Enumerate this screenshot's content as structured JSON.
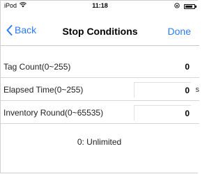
{
  "status_bar": {
    "carrier": "iPod",
    "wifi_icon": "wifi-icon",
    "time": "11:18",
    "battery_level": 0.8
  },
  "nav": {
    "back_label": "Back",
    "title": "Stop Conditions",
    "done_label": "Done",
    "accent_color": "#2a7bf6"
  },
  "fields": {
    "tag_count": {
      "label": "Tag Count(0~255)",
      "value": "0"
    },
    "elapsed_time": {
      "label": "Elapsed Time(0~255)",
      "value": "0",
      "unit": "s"
    },
    "inventory_round": {
      "label": "Inventory Round(0~65535)",
      "value": "0"
    }
  },
  "hint": "0: Unlimited"
}
